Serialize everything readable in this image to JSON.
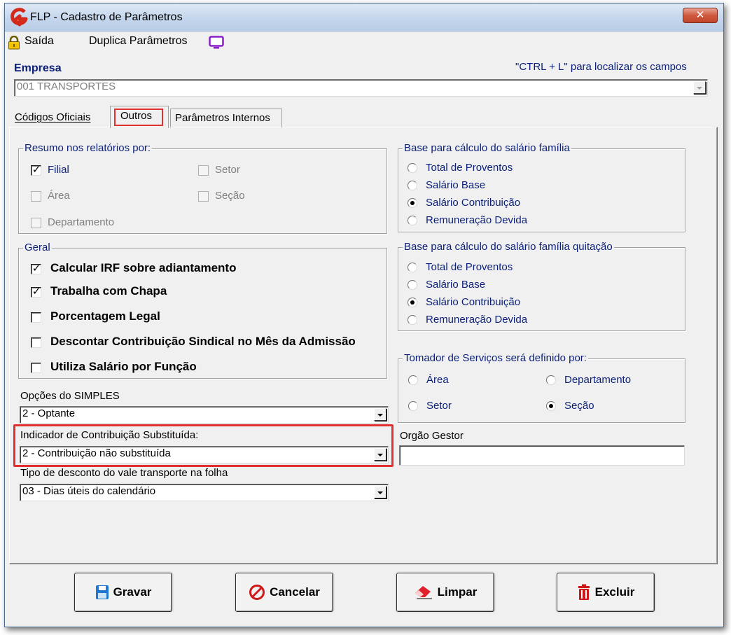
{
  "window": {
    "title": "FLP - Cadastro de Parâmetros",
    "close_label": "✕"
  },
  "toolbar": {
    "exit_label": "Saída",
    "duplicate_label": "Duplica Parâmetros"
  },
  "empresa": {
    "label": "Empresa",
    "hint": "\"CTRL + L\" para localizar os campos",
    "value": "001 TRANSPORTES"
  },
  "tabs": [
    {
      "label": "Códigos Oficiais"
    },
    {
      "label": "Outros"
    },
    {
      "label": "Parâmetros Internos"
    }
  ],
  "resumo": {
    "legend": "Resumo nos relatórios por:",
    "items": [
      {
        "label": "Filial",
        "checked": true
      },
      {
        "label": "Setor",
        "checked": false
      },
      {
        "label": "Área",
        "checked": false
      },
      {
        "label": "Seção",
        "checked": false
      },
      {
        "label": "Departamento",
        "checked": false
      }
    ]
  },
  "geral": {
    "legend": "Geral",
    "items": [
      {
        "label": "Calcular IRF sobre adiantamento",
        "checked": true
      },
      {
        "label": "Trabalha com Chapa",
        "checked": true
      },
      {
        "label": "Porcentagem Legal",
        "checked": false
      },
      {
        "label": "Descontar Contribuição Sindical no Mês da  Admissão",
        "checked": false
      },
      {
        "label": "Utiliza Salário por Função",
        "checked": false
      }
    ]
  },
  "base_familia": {
    "legend": "Base para cálculo do salário família",
    "options": [
      "Total de Proventos",
      "Salário Base",
      "Salário Contribuição",
      "Remuneração Devida"
    ],
    "selected": "Salário Contribuição"
  },
  "base_quitacao": {
    "legend": "Base para cálculo do salário família quitação",
    "options": [
      "Total de Proventos",
      "Salário Base",
      "Salário Contribuição",
      "Remuneração Devida"
    ],
    "selected": "Salário Contribuição"
  },
  "tomador": {
    "legend": "Tomador de Serviços será definido por:",
    "options": [
      "Área",
      "Departamento",
      "Setor",
      "Seção"
    ],
    "selected": "Seção"
  },
  "simples": {
    "label": "Opções do SIMPLES",
    "value": "2 - Optante"
  },
  "contribuicao": {
    "label": "Indicador de Contribuição Substituída:",
    "value": "2 - Contribuição não substituída",
    "highlight_color": "#e03030"
  },
  "vale": {
    "label": "Tipo de desconto do vale transporte na folha",
    "value": "03 - Dias úteis do calendário"
  },
  "orgao": {
    "label": "Orgão Gestor",
    "value": ""
  },
  "buttons": {
    "save": "Gravar",
    "cancel": "Cancelar",
    "clear": "Limpar",
    "delete": "Excluir"
  }
}
